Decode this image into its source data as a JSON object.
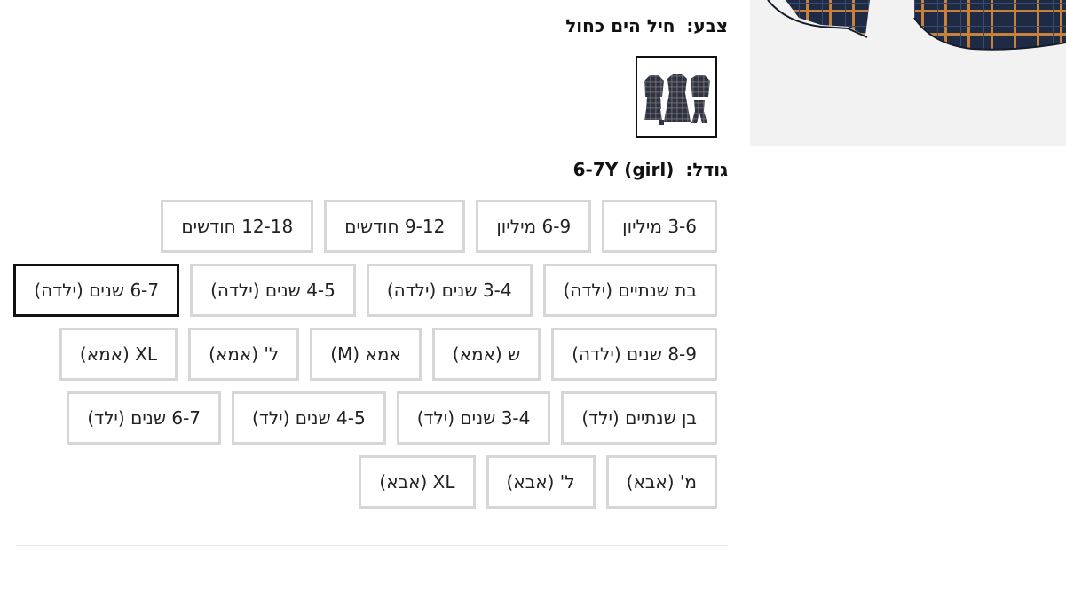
{
  "product_image": {
    "icon": "plaid-shirt-photo",
    "colors": {
      "navy": "#1f2a44",
      "orange": "#c8813a",
      "background": "#f3f2f2"
    }
  },
  "color_option": {
    "label": "צבע:",
    "value": "חיל הים כחול",
    "swatch_icon": "family-plaid-outfits-thumbnail"
  },
  "size_option": {
    "label": "גודל:",
    "value": "6-7Y (girl)",
    "selected_border_color": "#111111",
    "default_border_color": "#d6d6d6",
    "rows": [
      [
        {
          "label": "3-6 מיליון",
          "selected": false
        },
        {
          "label": "6-9 מיליון",
          "selected": false
        },
        {
          "label": "9-12 חודשים",
          "selected": false
        },
        {
          "label": "12-18 חודשים",
          "selected": false
        }
      ],
      [
        {
          "label": "בת שנתיים (ילדה)",
          "selected": false
        },
        {
          "label": "3-4 שנים (ילדה)",
          "selected": false
        },
        {
          "label": "4-5 שנים (ילדה)",
          "selected": false
        },
        {
          "label": "6-7 שנים (ילדה)",
          "selected": true
        }
      ],
      [
        {
          "label": "8-9 שנים (ילדה)",
          "selected": false
        },
        {
          "label": "ש (אמא)",
          "selected": false
        },
        {
          "label": "אמא (M)",
          "selected": false
        },
        {
          "label": "ל' (אמא)",
          "selected": false
        },
        {
          "label": "XL (אמא)",
          "selected": false
        }
      ],
      [
        {
          "label": "בן שנתיים (ילד)",
          "selected": false
        },
        {
          "label": "3-4 שנים (ילד)",
          "selected": false
        },
        {
          "label": "4-5 שנים (ילד)",
          "selected": false
        },
        {
          "label": "6-7 שנים (ילד)",
          "selected": false
        }
      ],
      [
        {
          "label": "מ' (אבא)",
          "selected": false
        },
        {
          "label": "ל' (אבא)",
          "selected": false
        },
        {
          "label": "XL (אבא)",
          "selected": false
        }
      ]
    ]
  }
}
